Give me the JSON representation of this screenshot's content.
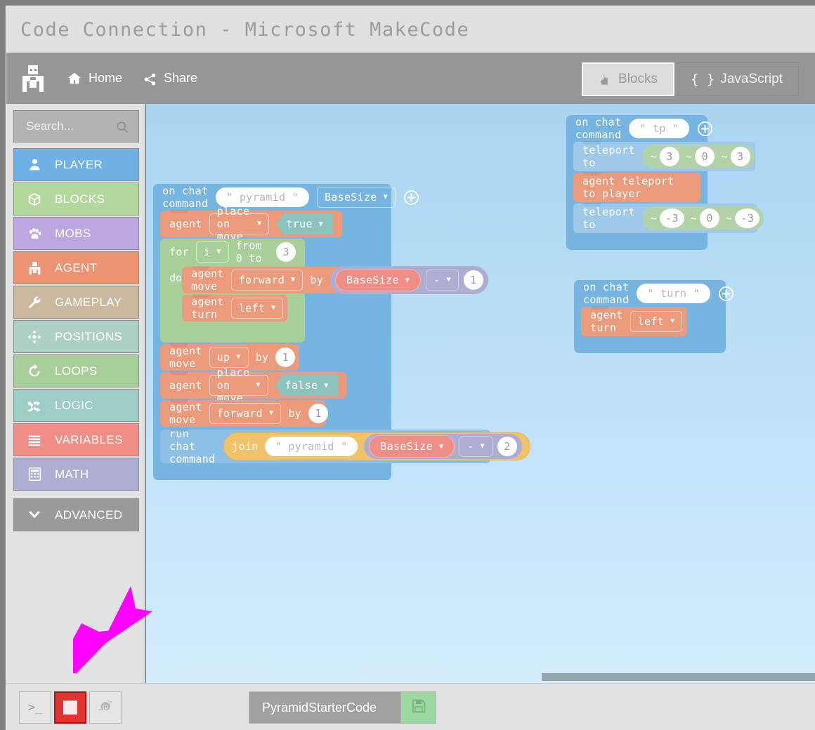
{
  "window": {
    "title": "Code Connection - Microsoft MakeCode"
  },
  "menubar": {
    "logo_icon": "minecraft-agent-icon",
    "items": [
      {
        "label": "Home",
        "icon": "home-icon"
      },
      {
        "label": "Share",
        "icon": "share-icon"
      }
    ],
    "tabs": [
      {
        "label": "Blocks",
        "icon": "puzzle-icon",
        "active": true
      },
      {
        "label": "JavaScript",
        "icon": "curly-braces-icon",
        "active": false
      }
    ]
  },
  "sidebar": {
    "search": {
      "placeholder": "Search...",
      "value": "",
      "icon": "search-icon"
    },
    "categories": [
      {
        "label": "PLAYER",
        "color": "#6fb1e4",
        "icon": "person-icon"
      },
      {
        "label": "BLOCKS",
        "color": "#b3d89c",
        "icon": "cube-icon"
      },
      {
        "label": "MOBS",
        "color": "#bda7e0",
        "icon": "paw-icon"
      },
      {
        "label": "AGENT",
        "color": "#ed9371",
        "icon": "agent-robot-icon"
      },
      {
        "label": "GAMEPLAY",
        "color": "#cbb99f",
        "icon": "wrench-icon"
      },
      {
        "label": "POSITIONS",
        "color": "#aed0c4",
        "icon": "move-arrows-icon"
      },
      {
        "label": "LOOPS",
        "color": "#a8cf9a",
        "icon": "loop-arrow-icon"
      },
      {
        "label": "LOGIC",
        "color": "#9ecdc6",
        "icon": "shuffle-icon"
      },
      {
        "label": "VARIABLES",
        "color": "#ef8e86",
        "icon": "lines-icon"
      },
      {
        "label": "MATH",
        "color": "#aeaed4",
        "icon": "calculator-icon"
      },
      {
        "label": "ADVANCED",
        "color": "#9a9a9a",
        "icon": "chevron-down-icon"
      }
    ]
  },
  "canvas": {
    "scrollbar": {
      "name": "horizontal-scrollbar"
    },
    "programs": {
      "pyramid": {
        "hat": {
          "prefix": "on chat command",
          "command": "\" pyramid \"",
          "param": "BaseSize",
          "add_icon": "plus-circle-icon"
        },
        "place_on_move_true": {
          "prefix": "agent",
          "dropdown": "place on move",
          "bool": "true"
        },
        "for_loop": {
          "for": "for",
          "var": "i",
          "from_to": "from 0 to",
          "to_value": "3",
          "do": "do",
          "body": {
            "move": {
              "prefix": "agent move",
              "direction": "forward",
              "by": "by",
              "math": {
                "left_var": "BaseSize",
                "operator": "-",
                "right_num": "1"
              }
            },
            "turn": {
              "prefix": "agent turn",
              "direction": "left"
            }
          }
        },
        "move_up": {
          "prefix": "agent move",
          "direction": "up",
          "by": "by",
          "value": "1"
        },
        "place_on_move_false": {
          "prefix": "agent",
          "dropdown": "place on move",
          "bool": "false"
        },
        "move_forward": {
          "prefix": "agent move",
          "direction": "forward",
          "by": "by",
          "value": "1"
        },
        "run_chat": {
          "prefix": "run chat command",
          "join_label": "join",
          "join_text": "\" pyramid \"",
          "math": {
            "left_var": "BaseSize",
            "operator": "-",
            "right_num": "2"
          }
        }
      },
      "tp": {
        "hat": {
          "prefix": "on chat command",
          "command": "\" tp \"",
          "add_icon": "plus-circle-icon"
        },
        "teleport_1": {
          "label": "teleport to",
          "x": "3",
          "y": "0",
          "z": "3",
          "tilde": "~"
        },
        "agent_teleport": {
          "label": "agent teleport to player"
        },
        "teleport_2": {
          "label": "teleport to",
          "x": "-3",
          "y": "0",
          "z": "-3",
          "tilde": "~"
        }
      },
      "turn": {
        "hat": {
          "prefix": "on chat command",
          "command": "\" turn \"",
          "add_icon": "plus-circle-icon"
        },
        "agent_turn": {
          "prefix": "agent turn",
          "direction": "left"
        }
      }
    }
  },
  "bottombar": {
    "buttons": [
      {
        "name": "terminal-button",
        "icon": "terminal-icon",
        "label": ">_"
      },
      {
        "name": "stop-button",
        "icon": "stop-square-icon",
        "label": ""
      },
      {
        "name": "snail-button",
        "icon": "snail-icon",
        "label": ""
      }
    ],
    "project_name": "PyramidStarterCode",
    "save_icon": "floppy-disk-icon"
  },
  "annotation": {
    "name": "magenta-double-arrow-cursor",
    "color": "#ff00ff"
  }
}
